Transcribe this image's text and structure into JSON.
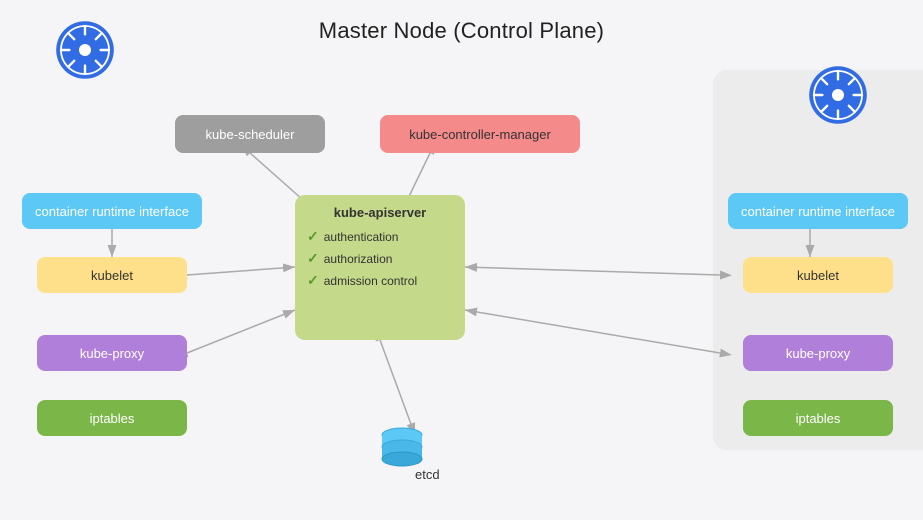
{
  "title": "Master Node (Control Plane)",
  "nodes": {
    "scheduler": "kube-scheduler",
    "controller": "kube-controller-manager",
    "apiserver": {
      "title": "kube-apiserver",
      "items": [
        "authentication",
        "authorization",
        "admission control"
      ]
    },
    "cri_left": "container runtime interface",
    "kubelet_left": "kubelet",
    "proxy_left": "kube-proxy",
    "iptables_left": "iptables",
    "cri_right": "container runtime interface",
    "kubelet_right": "kubelet",
    "proxy_right": "kube-proxy",
    "iptables_right": "iptables",
    "etcd": "etcd"
  },
  "colors": {
    "scheduler_bg": "#9e9e9e",
    "controller_bg": "#f48a8a",
    "apiserver_bg": "#c5d98a",
    "cri_bg": "#5bc8f5",
    "kubelet_bg": "#ffe08a",
    "proxy_bg": "#b07fda",
    "iptables_bg": "#7ab648",
    "k8s_blue": "#326ce5"
  }
}
